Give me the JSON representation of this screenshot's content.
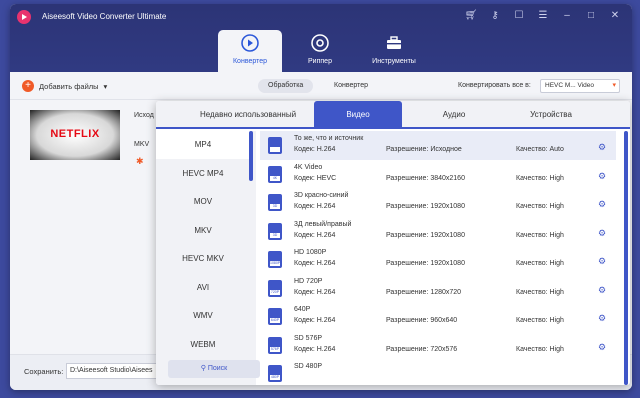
{
  "app": {
    "title": "Aiseesoft Video Converter Ultimate"
  },
  "main_tabs": [
    {
      "label": "Конвертер"
    },
    {
      "label": "Риппер"
    },
    {
      "label": "Инструменты"
    }
  ],
  "toolbar": {
    "add_files": "Добавить файлы",
    "processing": "Обработка",
    "converter": "Конвертер",
    "convert_all_label": "Конвертировать все в:",
    "convert_all_value": "HEVC M... Video"
  },
  "file": {
    "thumb_text": "NETFLIX",
    "source_label": "Исход",
    "format_label": "MKV"
  },
  "bottom": {
    "save_label": "Сохранить:",
    "save_path": "D:\\Aiseesoft Studio\\Aisees"
  },
  "dropdown": {
    "tabs": [
      {
        "label": "Недавно использованный"
      },
      {
        "label": "Видео"
      },
      {
        "label": "Аудио"
      },
      {
        "label": "Устройства"
      }
    ],
    "formats": [
      "MP4",
      "HEVC MP4",
      "MOV",
      "MKV",
      "HEVC MKV",
      "AVI",
      "WMV",
      "WEBM"
    ],
    "search_label": "Поиск",
    "presets": [
      {
        "name": "То же, что и источник",
        "codec": "Кодек: H.264",
        "resolution": "Разрешение: Исходное",
        "quality": "Качество: Auto",
        "badge": ""
      },
      {
        "name": "4K Video",
        "codec": "Кодек: HEVC",
        "resolution": "Разрешение: 3840x2160",
        "quality": "Качество: High",
        "badge": "4K"
      },
      {
        "name": "3D красно-синий",
        "codec": "Кодек: H.264",
        "resolution": "Разрешение: 1920x1080",
        "quality": "Качество: High",
        "badge": "3D"
      },
      {
        "name": "3Д левый/правый",
        "codec": "Кодек: H.264",
        "resolution": "Разрешение: 1920x1080",
        "quality": "Качество: High",
        "badge": "3D"
      },
      {
        "name": "HD 1080P",
        "codec": "Кодек: H.264",
        "resolution": "Разрешение: 1920x1080",
        "quality": "Качество: High",
        "badge": "1080P"
      },
      {
        "name": "HD 720P",
        "codec": "Кодек: H.264",
        "resolution": "Разрешение: 1280x720",
        "quality": "Качество: High",
        "badge": "720P"
      },
      {
        "name": "640P",
        "codec": "Кодек: H.264",
        "resolution": "Разрешение: 960x640",
        "quality": "Качество: High",
        "badge": "640P"
      },
      {
        "name": "SD 576P",
        "codec": "Кодек: H.264",
        "resolution": "Разрешение: 720x576",
        "quality": "Качество: High",
        "badge": "576P"
      },
      {
        "name": "SD 480P",
        "codec": "",
        "resolution": "",
        "quality": "",
        "badge": "480P"
      }
    ]
  },
  "colors": {
    "accent": "#3f56c8",
    "orange": "#f05a28",
    "titlebar": "#2c3476"
  },
  "icons": [
    "app-logo-icon",
    "cart-icon",
    "key-icon",
    "chat-icon",
    "menu-icon",
    "minimize-icon",
    "maximize-icon",
    "close-icon",
    "converter-icon",
    "ripper-icon",
    "toolbox-icon",
    "gear-icon",
    "search-icon",
    "star-icon"
  ]
}
